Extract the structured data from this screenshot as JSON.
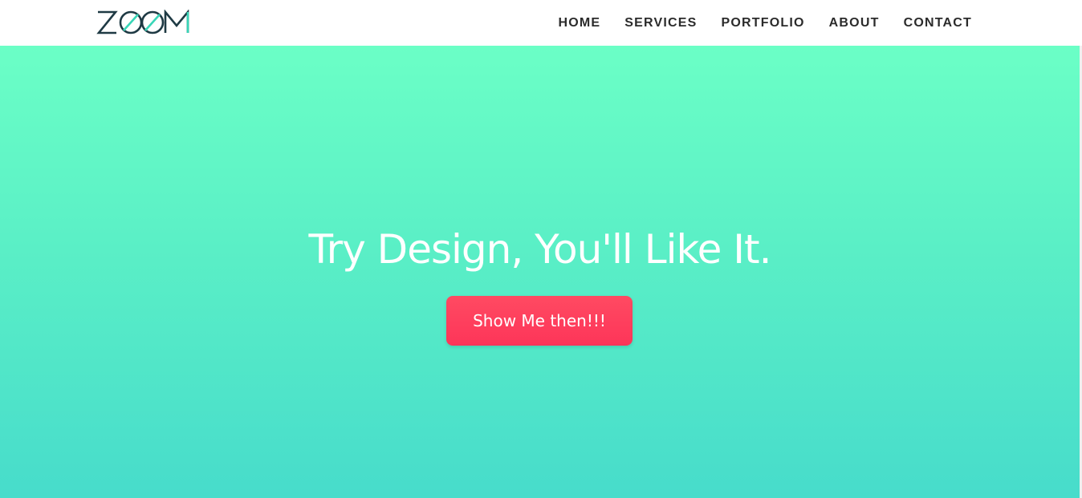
{
  "brand": {
    "logo_text": "ZOOM",
    "colors": {
      "dark": "#1f3a44",
      "accent": "#38d6b7"
    }
  },
  "nav": {
    "items": [
      {
        "label": "HOME"
      },
      {
        "label": "SERVICES"
      },
      {
        "label": "PORTFOLIO"
      },
      {
        "label": "ABOUT"
      },
      {
        "label": "CONTACT"
      }
    ]
  },
  "hero": {
    "headline": "Try Design, You'll Like It.",
    "cta_label": "Show Me then!!!",
    "colors": {
      "gradient_top": "#6bffc6",
      "gradient_bottom": "#47dccb",
      "cta": "#fd3f5e"
    }
  }
}
